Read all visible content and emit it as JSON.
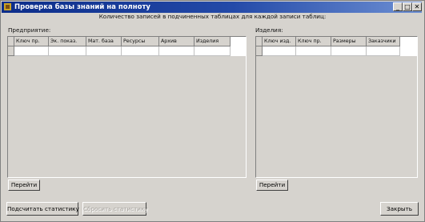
{
  "window": {
    "title": "Проверка базы знаний на полноту",
    "buttons": {
      "minimize": "_",
      "maximize": "□",
      "close": "✕"
    }
  },
  "caption": "Количество записей в подчиненных таблицах для каждой записи таблиц:",
  "left_panel": {
    "label": "Предприятие:",
    "columns": [
      "Ключ пр.",
      "Эк. показ.",
      "Мат. база",
      "Ресурсы",
      "Архив",
      "Изделия"
    ],
    "goto_label": "Перейти"
  },
  "right_panel": {
    "label": "Изделия:",
    "columns": [
      "Ключ изд.",
      "Ключ пр.",
      "Размеры",
      "Заказчики"
    ],
    "goto_label": "Перейти"
  },
  "footer": {
    "count_label": "Подсчитать статистику",
    "reset_label": "Сбросить статистику",
    "close_label": "Закрыть"
  }
}
